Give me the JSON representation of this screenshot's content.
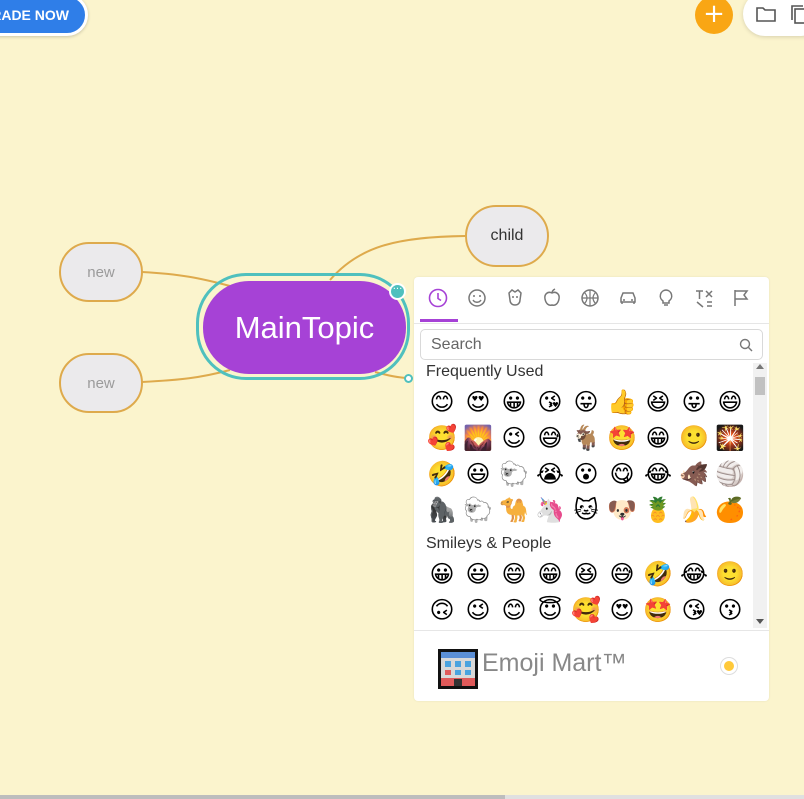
{
  "toolbar": {
    "upgrade_label": "RADE NOW",
    "add_label": "+"
  },
  "mindmap": {
    "main_topic": "MainTopic",
    "child": "child",
    "left_nodes": [
      "new",
      "new"
    ],
    "colors": {
      "main": "#a642d6",
      "selection": "#4fc0be",
      "link": "#deaa4c",
      "subnode": "#ebeaec",
      "background": "#fbf4cd"
    }
  },
  "emoji_picker": {
    "categories": [
      "recent-icon",
      "smileys-icon",
      "animals-icon",
      "food-icon",
      "activity-icon",
      "travel-icon",
      "objects-icon",
      "symbols-icon",
      "flags-icon"
    ],
    "active_category": "recent-icon",
    "search_placeholder": "Search",
    "frequently_used_label": "Frequently Used",
    "smileys_label": "Smileys & People",
    "frequently_used": [
      [
        "😊",
        "😍",
        "😀",
        "😘",
        "😛",
        "👍",
        "😆",
        "😛",
        "😄"
      ],
      [
        "🥰",
        "🌄",
        "😉",
        "😅",
        "🐐",
        "🤩",
        "😁",
        "🙂",
        "🎇"
      ],
      [
        "🤣",
        "😃",
        "🐑",
        "😭",
        "😮",
        "😋",
        "😂",
        "🐗",
        "🏐"
      ],
      [
        "🦍",
        "🐑",
        "🐪",
        "🦄",
        "🐱",
        "🐶",
        "🍍",
        "🍌",
        "🍊"
      ]
    ],
    "smileys": [
      [
        "😀",
        "😃",
        "😄",
        "😁",
        "😆",
        "😅",
        "🤣",
        "😂",
        "🙂"
      ],
      [
        "🙃",
        "😉",
        "😊",
        "😇",
        "🥰",
        "😍",
        "🤩",
        "😘",
        "😗"
      ]
    ],
    "preview_title": "Emoji Mart™",
    "skin_tone_color": "#ffc93a"
  }
}
